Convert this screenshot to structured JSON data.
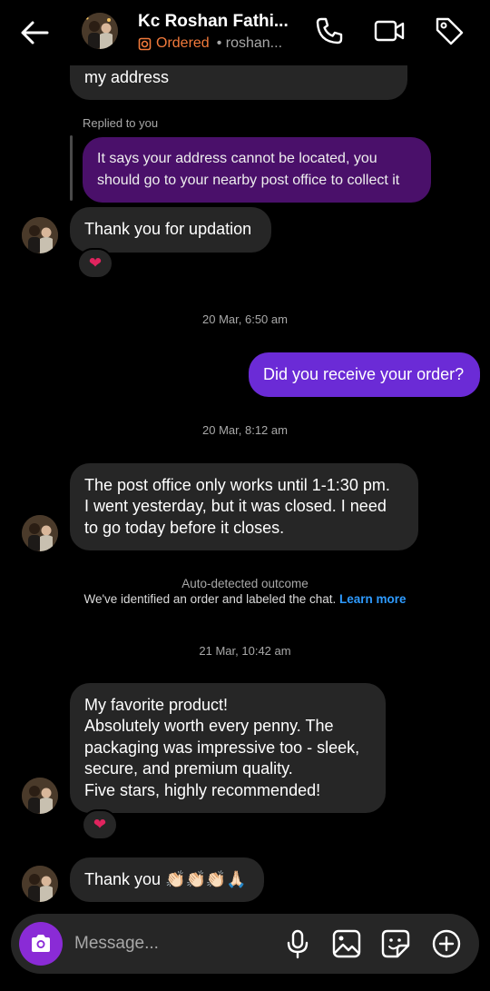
{
  "header": {
    "name": "Kc Roshan Fathi...",
    "status": "Ordered",
    "username": "• roshan...",
    "icons": [
      "back-arrow-icon",
      "phone-icon",
      "video-icon",
      "tag-icon",
      "ordered-status-icon"
    ]
  },
  "messages": {
    "partial_msg": "my address",
    "replied_label": "Replied to you",
    "quoted_line1": "It says your address cannot be located, you",
    "quoted_line2": "should go to your nearby post office to collect it",
    "msg1": "Thank you for updation",
    "reaction1": "❤",
    "ts1": "20 Mar, 6:50 am",
    "sent1": "Did you receive your order?",
    "ts2": "20 Mar, 8:12 am",
    "msg2_line1": "The post office only works until 1-1:30 pm.",
    "msg2_line2": "I went yesterday, but it was closed. I need",
    "msg2_line3": "to go today before it closes.",
    "auto_title": "Auto-detected outcome",
    "auto_body": "We've identified an order and labeled the chat.",
    "learn_more": "Learn more",
    "ts3": "21 Mar, 10:42 am",
    "msg3_line1": "My favorite product!",
    "msg3_line2": "Absolutely worth every penny. The",
    "msg3_line3": "packaging was impressive too - sleek,",
    "msg3_line4": "secure, and premium quality.",
    "msg3_line5": "Five stars, highly recommended!",
    "reaction2": "❤",
    "msg4": "Thank you 👏🏻👏🏻👏🏻🙏🏻"
  },
  "composer": {
    "placeholder": "Message...",
    "icons": [
      "camera-icon",
      "microphone-icon",
      "gallery-icon",
      "sticker-icon",
      "plus-icon"
    ]
  },
  "colors": {
    "sent_bubble": "#6b2bd6",
    "quoted_bubble": "#4a106a",
    "received_bubble": "#262626",
    "status_orange": "#f27a3b",
    "link_blue": "#2e9bff",
    "camera_button": "#8a2bd6"
  }
}
